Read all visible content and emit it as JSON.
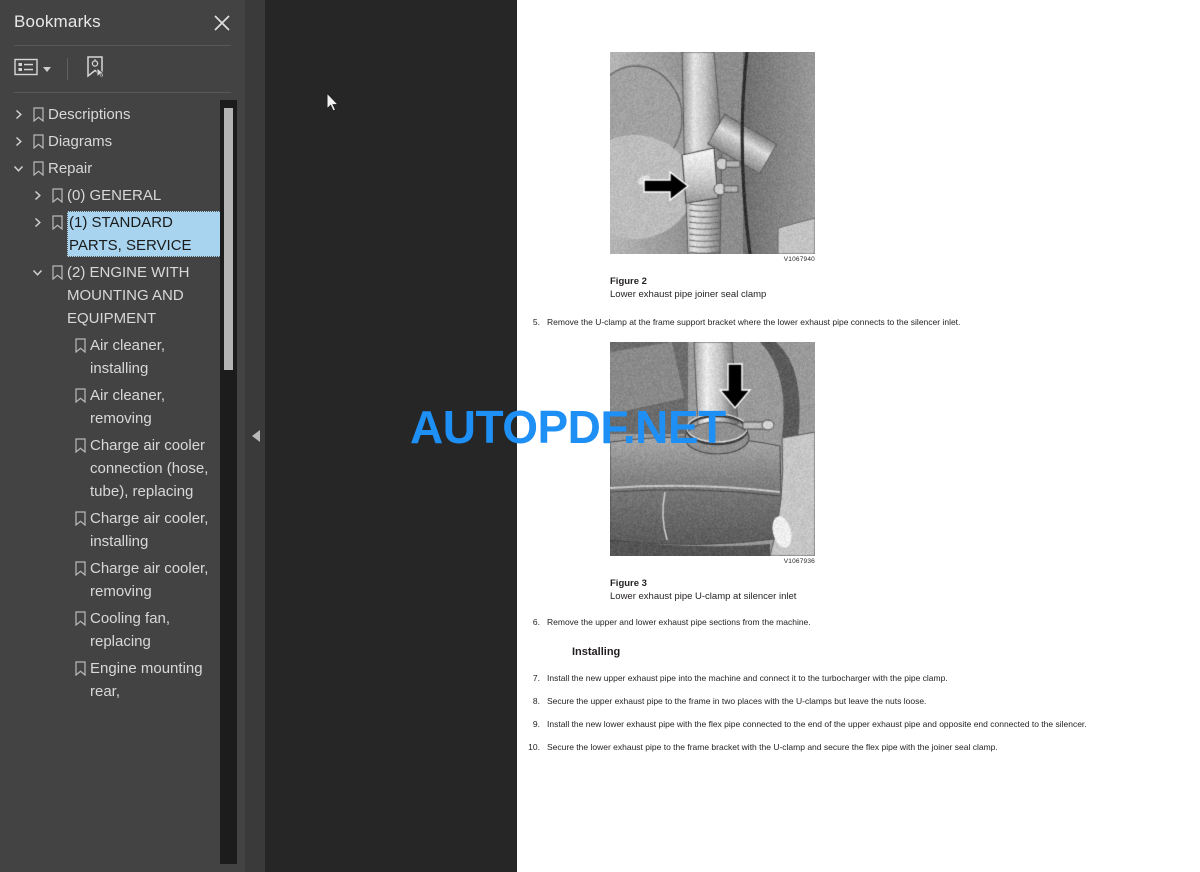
{
  "sidebar": {
    "title": "Bookmarks",
    "close_icon": "close-icon",
    "toolbar": {
      "list_options_label": "list-options-icon",
      "dropdown_icon": "chevron-down-icon",
      "new_bookmark_label": "new-bookmark-icon"
    },
    "tree": [
      {
        "label": "Descriptions",
        "level": 0,
        "state": "collapsed",
        "selected": false
      },
      {
        "label": "Diagrams",
        "level": 0,
        "state": "collapsed",
        "selected": false
      },
      {
        "label": "Repair",
        "level": 0,
        "state": "expanded",
        "selected": false
      },
      {
        "label": "(0) GENERAL",
        "level": 1,
        "state": "collapsed",
        "selected": false
      },
      {
        "label": "(1) STANDARD PARTS, SERVICE",
        "level": 1,
        "state": "collapsed",
        "selected": true
      },
      {
        "label": "(2) ENGINE WITH MOUNTING AND EQUIPMENT",
        "level": 1,
        "state": "expanded",
        "selected": false
      },
      {
        "label": "Air cleaner, installing",
        "level": 2,
        "state": "leaf",
        "selected": false
      },
      {
        "label": "Air cleaner, removing",
        "level": 2,
        "state": "leaf",
        "selected": false
      },
      {
        "label": "Charge air cooler connection (hose, tube), replacing",
        "level": 2,
        "state": "leaf",
        "selected": false
      },
      {
        "label": "Charge air cooler, installing",
        "level": 2,
        "state": "leaf",
        "selected": false
      },
      {
        "label": "Charge air cooler, removing",
        "level": 2,
        "state": "leaf",
        "selected": false
      },
      {
        "label": "Cooling fan, replacing",
        "level": 2,
        "state": "leaf",
        "selected": false
      },
      {
        "label": "Engine mounting rear,",
        "level": 2,
        "state": "leaf",
        "selected": false
      }
    ]
  },
  "viewer": {
    "collapse_handle_icon": "triangle-left-icon",
    "watermark": "AUTOPDF.NET",
    "watermark_color": "#1e90f5"
  },
  "page": {
    "figures": [
      {
        "id": "V1067940",
        "caption_title": "Figure 2",
        "caption_text": "Lower exhaust pipe joiner seal clamp",
        "arrow": "arrow-right"
      },
      {
        "id": "V1067936",
        "caption_title": "Figure 3",
        "caption_text": "Lower exhaust pipe U-clamp at silencer inlet",
        "arrow": "arrow-down"
      }
    ],
    "steps_before_installing": [
      {
        "num": "5.",
        "text": "Remove the U-clamp at the frame support bracket where the lower exhaust pipe connects to the silencer inlet."
      },
      {
        "num": "6.",
        "text": "Remove the upper and lower exhaust pipe sections from the machine."
      }
    ],
    "installing_heading": "Installing",
    "installing_steps": [
      {
        "num": "7.",
        "text": "Install the new upper exhaust pipe into the machine and connect it to the turbocharger with the pipe clamp."
      },
      {
        "num": "8.",
        "text": "Secure the upper exhaust pipe to the frame in two places with the U-clamps but leave the nuts loose."
      },
      {
        "num": "9.",
        "text": "Install the new lower exhaust pipe with the flex pipe connected to the end of the upper exhaust pipe and opposite end connected to the silencer."
      },
      {
        "num": "10.",
        "text": "Secure the lower exhaust pipe to the frame bracket with the U-clamp and secure the flex pipe with the joiner seal clamp."
      }
    ]
  }
}
